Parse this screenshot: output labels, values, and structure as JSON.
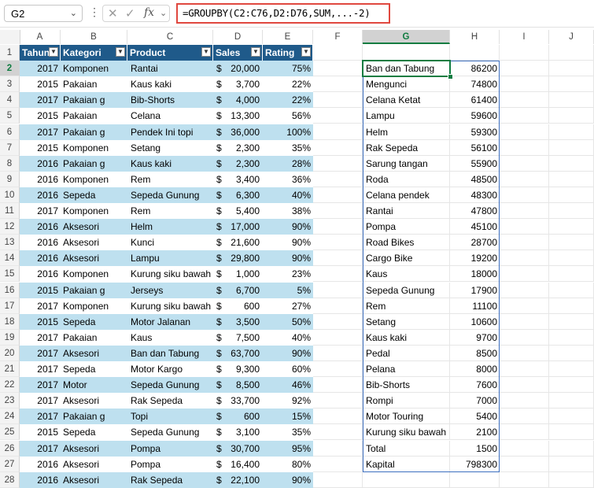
{
  "formula_bar": {
    "name_box": "G2",
    "cancel_icon": "✕",
    "enter_icon": "✓",
    "fx_icon": "fx",
    "formula": "=GROUPBY(C2:C76,D2:D76,SUM,...-2)"
  },
  "columns": [
    "A",
    "B",
    "C",
    "D",
    "E",
    "F",
    "G",
    "H",
    "I",
    "J"
  ],
  "selected_column": "G",
  "selected_row": 2,
  "row_numbers": [
    1,
    2,
    3,
    4,
    5,
    6,
    7,
    8,
    9,
    10,
    11,
    12,
    13,
    14,
    15,
    16,
    17,
    18,
    19,
    20,
    21,
    22,
    23,
    24,
    25,
    26,
    27,
    28
  ],
  "table": {
    "headers": [
      "Tahun",
      "Kategori",
      "Product",
      "Sales",
      "Rating"
    ],
    "rows": [
      {
        "year": "2017",
        "cat": "Komponen",
        "prod": "Rantai",
        "sales_c": "$",
        "sales": "20,000",
        "rating": "75%"
      },
      {
        "year": "2015",
        "cat": "Pakaian",
        "prod": "Kaus kaki",
        "sales_c": "$",
        "sales": "3,700",
        "rating": "22%"
      },
      {
        "year": "2017",
        "cat": "Pakaian      g",
        "prod": "Bib-Shorts",
        "sales_c": "$",
        "sales": "4,000",
        "rating": "22%"
      },
      {
        "year": "2015",
        "cat": "Pakaian",
        "prod": "Celana",
        "sales_c": "$",
        "sales": "13,300",
        "rating": "56%"
      },
      {
        "year": "2017",
        "cat": "Pakaian      g",
        "prod": "Pendek Ini topi",
        "sales_c": "$",
        "sales": "36,000",
        "rating": "100%"
      },
      {
        "year": "2015",
        "cat": "Komponen",
        "prod": "Setang",
        "sales_c": "$",
        "sales": "2,300",
        "rating": "35%"
      },
      {
        "year": "2016",
        "cat": "Pakaian      g",
        "prod": "Kaus kaki",
        "sales_c": "$",
        "sales": "2,300",
        "rating": "28%"
      },
      {
        "year": "2016",
        "cat": "Komponen",
        "prod": "Rem",
        "sales_c": "$",
        "sales": "3,400",
        "rating": "36%"
      },
      {
        "year": "2016",
        "cat": "Sepeda",
        "prod": "Sepeda Gunung",
        "sales_c": "$",
        "sales": "6,300",
        "rating": "40%"
      },
      {
        "year": "2017",
        "cat": "Komponen",
        "prod": "Rem",
        "sales_c": "$",
        "sales": "5,400",
        "rating": "38%"
      },
      {
        "year": "2016",
        "cat": "Aksesori",
        "prod": "Helm",
        "sales_c": "$",
        "sales": "17,000",
        "rating": "90%"
      },
      {
        "year": "2016",
        "cat": "Aksesori",
        "prod": "Kunci",
        "sales_c": "$",
        "sales": "21,600",
        "rating": "90%"
      },
      {
        "year": "2016",
        "cat": "Aksesori",
        "prod": "Lampu",
        "sales_c": "$",
        "sales": "29,800",
        "rating": "90%"
      },
      {
        "year": "2016",
        "cat": "Komponen",
        "prod": "Kurung siku bawah",
        "sales_c": "$",
        "sales": "1,000",
        "rating": "23%"
      },
      {
        "year": "2015",
        "cat": "Pakaian      g",
        "prod": "Jerseys",
        "sales_c": "$",
        "sales": "6,700",
        "rating": "5%"
      },
      {
        "year": "2017",
        "cat": "Komponen",
        "prod": "Kurung siku bawah",
        "sales_c": "$",
        "sales": "600",
        "rating": "27%"
      },
      {
        "year": "2015",
        "cat": "Sepeda",
        "prod": "Motor Jalanan",
        "sales_c": "$",
        "sales": "3,500",
        "rating": "50%"
      },
      {
        "year": "2017",
        "cat": "Pakaian",
        "prod": "Kaus",
        "sales_c": "$",
        "sales": "7,500",
        "rating": "40%"
      },
      {
        "year": "2017",
        "cat": "Aksesori",
        "prod": "Ban dan Tabung",
        "sales_c": "$",
        "sales": "63,700",
        "rating": "90%"
      },
      {
        "year": "2017",
        "cat": "Sepeda",
        "prod": "Motor Kargo",
        "sales_c": "$",
        "sales": "9,300",
        "rating": "60%"
      },
      {
        "year": "2017",
        "cat": "Motor",
        "prod": "Sepeda Gunung",
        "sales_c": "$",
        "sales": "8,500",
        "rating": "46%"
      },
      {
        "year": "2017",
        "cat": "Aksesori",
        "prod": "Rak Sepeda",
        "sales_c": "$",
        "sales": "33,700",
        "rating": "92%"
      },
      {
        "year": "2017",
        "cat": "Pakaian      g",
        "prod": "Topi",
        "sales_c": "$",
        "sales": "600",
        "rating": "15%"
      },
      {
        "year": "2015",
        "cat": "Sepeda",
        "prod": "Sepeda Gunung",
        "sales_c": "$",
        "sales": "3,100",
        "rating": "35%"
      },
      {
        "year": "2017",
        "cat": "Aksesori",
        "prod": "Pompa",
        "sales_c": "$",
        "sales": "30,700",
        "rating": "95%"
      },
      {
        "year": "2016",
        "cat": "Aksesori",
        "prod": "Pompa",
        "sales_c": "$",
        "sales": "16,400",
        "rating": "80%"
      },
      {
        "year": "2016",
        "cat": "Aksesori",
        "prod": "Rak Sepeda",
        "sales_c": "$",
        "sales": "22,100",
        "rating": "90%"
      }
    ]
  },
  "groupby": [
    {
      "label": "Ban dan Tabung",
      "value": "86200"
    },
    {
      "label": "Mengunci",
      "value": "74800"
    },
    {
      "label": "Celana Ketat",
      "value": "61400"
    },
    {
      "label": "Lampu",
      "value": "59600"
    },
    {
      "label": "Helm",
      "value": "59300"
    },
    {
      "label": "Rak Sepeda",
      "value": "56100"
    },
    {
      "label": "Sarung tangan",
      "value": "55900"
    },
    {
      "label": "Roda",
      "value": "48500"
    },
    {
      "label": "Celana pendek",
      "value": "48300"
    },
    {
      "label": "Rantai",
      "value": "47800"
    },
    {
      "label": "Pompa",
      "value": "45100"
    },
    {
      "label": "Road Bikes",
      "value": "28700"
    },
    {
      "label": "Cargo Bike",
      "value": "19200"
    },
    {
      "label": "Kaus",
      "value": "18000"
    },
    {
      "label": "Sepeda Gunung",
      "value": "17900"
    },
    {
      "label": "Rem",
      "value": "11100"
    },
    {
      "label": "Setang",
      "value": "10600"
    },
    {
      "label": "Kaus kaki",
      "value": "9700"
    },
    {
      "label": "Pedal",
      "value": "8500"
    },
    {
      "label": "Pelana",
      "value": "8000"
    },
    {
      "label": "Bib-Shorts",
      "value": "7600"
    },
    {
      "label": "Rompi",
      "value": "7000"
    },
    {
      "label": "Motor Touring",
      "value": "5400"
    },
    {
      "label": "Kurung siku bawah",
      "value": "2100"
    },
    {
      "label": "Total",
      "value": "1500"
    },
    {
      "label": "Kapital",
      "value": "798300"
    }
  ],
  "colors": {
    "header_fill": "#1f5a8a",
    "band_fill": "#bee0ef",
    "spill_border": "#3d6fbf",
    "active_cell": "#107c41",
    "formula_highlight": "#e0483f"
  }
}
